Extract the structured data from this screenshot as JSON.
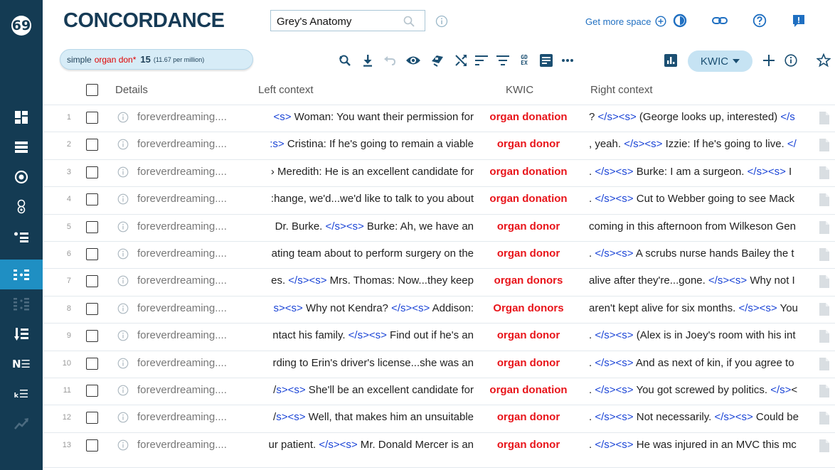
{
  "app": {
    "brand": "CONCORDANCE",
    "search_value": "Grey's Anatomy",
    "get_more_space": "Get more space"
  },
  "query": {
    "type": "simple",
    "text": "organ don*",
    "count": "15",
    "freq": "(11.67 per million)"
  },
  "toolbar": {
    "gdex_label": "GD EX",
    "view_mode": "KWIC"
  },
  "table": {
    "headers": {
      "details": "Details",
      "left": "Left context",
      "kwic": "KWIC",
      "right": "Right context"
    },
    "rows": [
      {
        "n": "1",
        "details": "foreverdreaming....",
        "left": "<s> Woman: You want their permission for",
        "kwic": "organ donation",
        "right": "? </s><s> (George looks up, interested) </s"
      },
      {
        "n": "2",
        "details": "foreverdreaming....",
        "left": ":s> Cristina: If he's going to remain a viable",
        "kwic": "organ donor",
        "right": ", yeah. </s><s> Izzie: If he's going to live. </"
      },
      {
        "n": "3",
        "details": "foreverdreaming....",
        "left": "› Meredith: He is an excellent candidate for",
        "kwic": "organ donation",
        "right": ". </s><s> Burke: I am a surgeon. </s><s> I"
      },
      {
        "n": "4",
        "details": "foreverdreaming....",
        "left": ":hange, we'd...we'd like to talk to you about",
        "kwic": "organ donation",
        "right": ". </s><s> Cut to Webber going to see Mack"
      },
      {
        "n": "5",
        "details": "foreverdreaming....",
        "left": "Dr. Burke. </s><s> Burke: Ah, we have an",
        "kwic": "organ donor",
        "right": "coming in this afternoon from Wilkeson Gen"
      },
      {
        "n": "6",
        "details": "foreverdreaming....",
        "left": "ating team about to perform surgery on the",
        "kwic": "organ donor",
        "right": ". </s><s> A scrubs nurse hands Bailey the t"
      },
      {
        "n": "7",
        "details": "foreverdreaming....",
        "left": "es. </s><s> Mrs. Thomas: Now...they keep",
        "kwic": "organ donors",
        "right": "alive after they're...gone. </s><s> Why not I"
      },
      {
        "n": "8",
        "details": "foreverdreaming....",
        "left": "s><s> Why not Kendra? </s><s> Addison:",
        "kwic": "Organ donors",
        "right": "aren't kept alive for six months. </s><s> You"
      },
      {
        "n": "9",
        "details": "foreverdreaming....",
        "left": "ntact his family. </s><s> Find out if he's an",
        "kwic": "organ donor",
        "right": ". </s><s> (Alex is in Joey's room with his int"
      },
      {
        "n": "10",
        "details": "foreverdreaming....",
        "left": "rding to Erin's driver's license...she was an",
        "kwic": "organ donor",
        "right": ". </s><s> And as next of kin, if you agree to"
      },
      {
        "n": "11",
        "details": "foreverdreaming....",
        "left": "/s><s> She'll be an excellent candidate for",
        "kwic": "organ donation",
        "right": ". </s><s> You got screwed by politics. </s><"
      },
      {
        "n": "12",
        "details": "foreverdreaming....",
        "left": "/s><s> Well, that makes him an unsuitable",
        "kwic": "organ donor",
        "right": ". </s><s> Not necessarily. </s><s> Could be"
      },
      {
        "n": "13",
        "details": "foreverdreaming....",
        "left": "ur patient. </s><s> Mr. Donald Mercer is an",
        "kwic": "organ donor",
        "right": ". </s><s> He was injured in an MVC this mc"
      }
    ]
  },
  "colors": {
    "sidebar_bg": "#143b53",
    "sidebar_active": "#1f8fc3",
    "brand": "#163b56",
    "kwic": "#e8141a",
    "tag": "#1a44d6",
    "link": "#1f6fc1"
  }
}
